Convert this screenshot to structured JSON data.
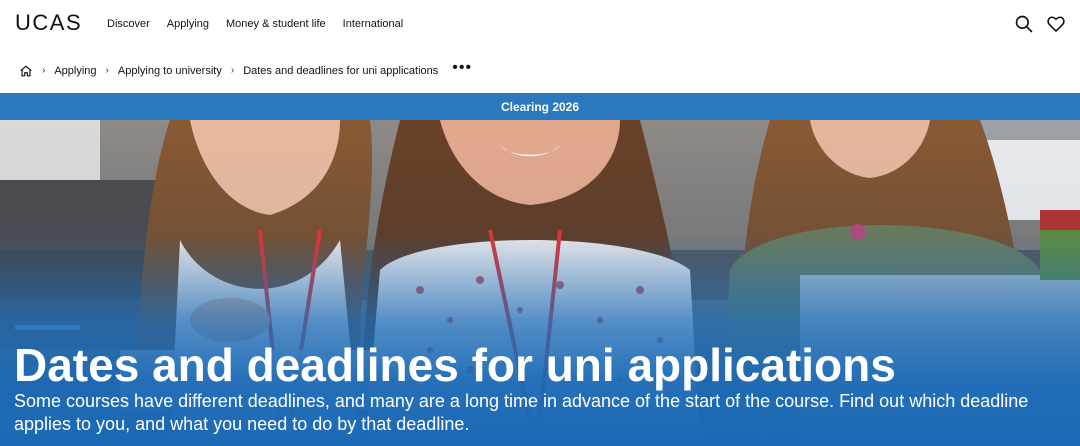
{
  "header": {
    "logo_text": "UCAS",
    "nav": [
      "Discover",
      "Applying",
      "Money & student life",
      "International"
    ],
    "search_icon": "search-icon",
    "favourites_icon": "heart-icon"
  },
  "breadcrumb": {
    "home_icon": "home-icon",
    "items": [
      "Applying",
      "Applying to university",
      "Dates and deadlines for uni applications"
    ],
    "more": "•••"
  },
  "banner": {
    "label": "Clearing 2026",
    "color": "#2a78be"
  },
  "hero": {
    "title": "Dates and deadlines for uni applications",
    "subtitle": "Some courses have different deadlines, and many are a long time in advance of the start of the course. Find out which deadline applies to you, and what you need to do by that deadline.",
    "image_description_icon": "students-photo"
  }
}
